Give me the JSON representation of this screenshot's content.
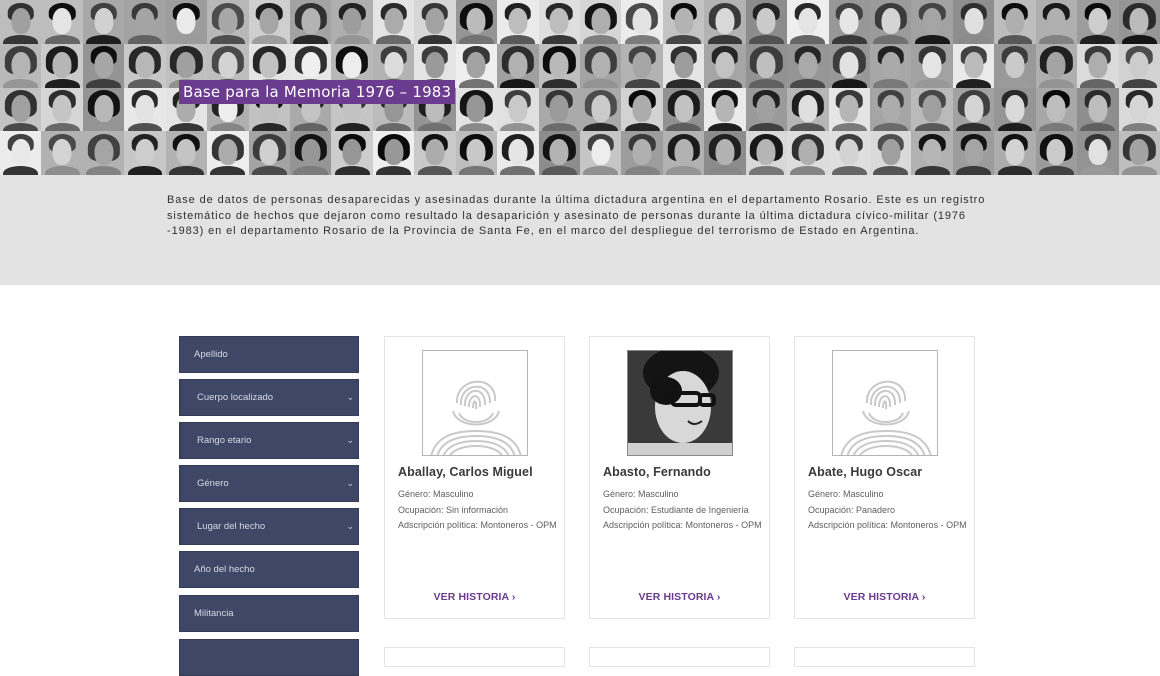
{
  "hero": {
    "title": "Base para la Memoria 1976 – 1983"
  },
  "description": "Base de datos de personas desaparecidas y asesinadas durante la última dictadura argentina en el departamento Rosario. Este es un registro sistemático de hechos que dejaron como resultado la desaparición y asesinato de personas durante la última dictadura cívico-militar (1976 -1983) en el departamento Rosario de la Provincia de Santa Fe, en el marco del despliegue del terrorismo de Estado en Argentina.",
  "filters": [
    {
      "label": "Apellido",
      "type": "input"
    },
    {
      "label": "Cuerpo localizado",
      "type": "select"
    },
    {
      "label": "Rango etario",
      "type": "select"
    },
    {
      "label": "Género",
      "type": "select"
    },
    {
      "label": "Lugar del hecho",
      "type": "select"
    },
    {
      "label": "Año del hecho",
      "type": "input"
    },
    {
      "label": "Militancia",
      "type": "input"
    },
    {
      "label": "",
      "type": "input"
    }
  ],
  "cards": [
    {
      "name": "Aballay, Carlos Miguel",
      "genero": "Género: Masculino",
      "ocupacion": "Ocupación: Sin información",
      "adscripcion": "Adscripción política: Montoneros - OPM",
      "photo": "fingerprint-placeholder",
      "link": "VER HISTORIA ›"
    },
    {
      "name": "Abasto, Fernando",
      "genero": "Género: Masculino",
      "ocupacion": "Ocupación: Estudiante de Ingeniería",
      "adscripcion": "Adscripción política: Montoneros - OPM",
      "photo": "bw-portrait-photo",
      "link": "VER HISTORIA ›"
    },
    {
      "name": "Abate, Hugo Oscar",
      "genero": "Género: Masculino",
      "ocupacion": "Ocupación: Panadero",
      "adscripcion": "Adscripción política: Montoneros - OPM",
      "photo": "fingerprint-placeholder",
      "link": "VER HISTORIA ›"
    }
  ],
  "colors": {
    "accent": "#6a3b8e",
    "filter_bg": "#3f4766",
    "band_bg": "#e3e3e3"
  }
}
